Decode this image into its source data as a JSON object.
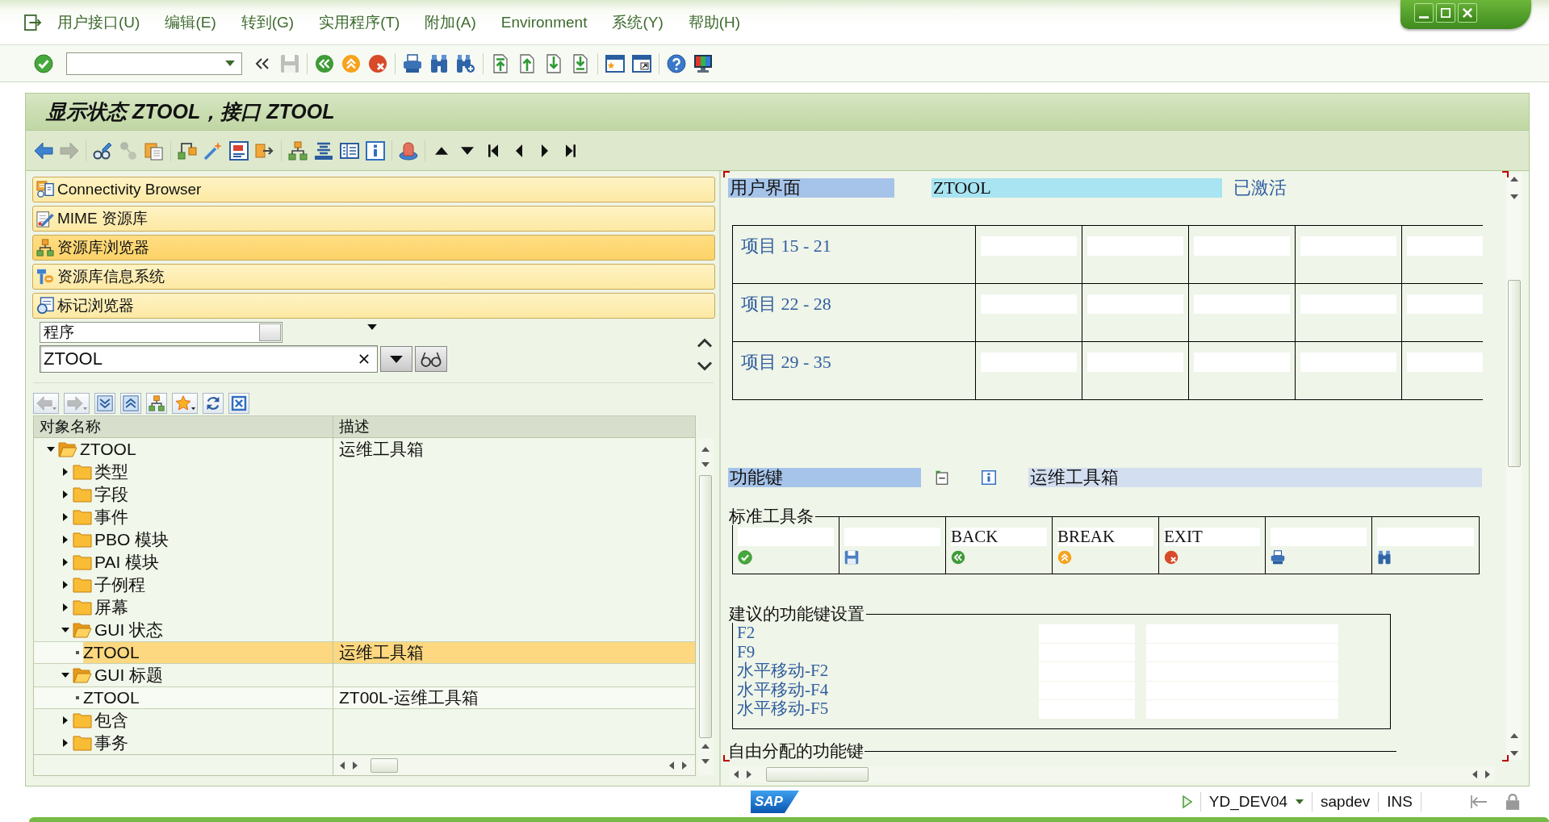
{
  "menu_bar": {
    "items": [
      "用户接口(U)",
      "编辑(E)",
      "转到(G)",
      "实用程序(T)",
      "附加(A)",
      "Environment",
      "系统(Y)",
      "帮助(H)"
    ]
  },
  "system_toolbar": {
    "save": {
      "disabled": true
    }
  },
  "title": "显示状态 ZTOOL，接口 ZTOOL",
  "application_toolbar": {
    "forward": {
      "disabled": true
    },
    "active_inactive": {
      "disabled": true
    }
  },
  "navigation": [
    {
      "label": "Connectivity Browser",
      "selected": false
    },
    {
      "label": "MIME 资源库",
      "selected": false
    },
    {
      "label": "资源库浏览器",
      "selected": true
    },
    {
      "label": "资源库信息系统",
      "selected": false
    },
    {
      "label": "标记浏览器",
      "selected": false
    }
  ],
  "object_selection": {
    "type_field": {
      "value": "程序"
    },
    "name_field": {
      "value": "ZTOOL"
    }
  },
  "tree_toolbar": {
    "back": {
      "disabled": true
    },
    "forward": {
      "disabled": true
    }
  },
  "object_tree": {
    "columns": [
      "对象名称",
      "描述"
    ],
    "nodes": [
      {
        "name": "ZTOOL",
        "description": "运维工具箱",
        "kind": "folder",
        "expanded": true,
        "selected": false,
        "children": [
          {
            "name": "类型",
            "kind": "folder",
            "expanded": false,
            "selected": false
          },
          {
            "name": "字段",
            "kind": "folder",
            "expanded": false,
            "selected": false
          },
          {
            "name": "事件",
            "kind": "folder",
            "expanded": false,
            "selected": false
          },
          {
            "name": "PBO 模块",
            "kind": "folder",
            "expanded": false,
            "selected": false
          },
          {
            "name": "PAI 模块",
            "kind": "folder",
            "expanded": false,
            "selected": false
          },
          {
            "name": "子例程",
            "kind": "folder",
            "expanded": false,
            "selected": false
          },
          {
            "name": "屏幕",
            "kind": "folder",
            "expanded": false,
            "selected": false
          },
          {
            "name": "GUI 状态",
            "kind": "folder",
            "expanded": true,
            "selected": false,
            "children": [
              {
                "name": "ZTOOL",
                "description": "运维工具箱",
                "kind": "object",
                "selected": true
              }
            ]
          },
          {
            "name": "GUI 标题",
            "kind": "folder",
            "expanded": true,
            "selected": false,
            "children": [
              {
                "name": "ZTOOL",
                "description": "ZT00L-运维工具箱",
                "kind": "object",
                "selected": false
              }
            ]
          },
          {
            "name": "包含",
            "kind": "folder",
            "expanded": false,
            "selected": false
          },
          {
            "name": "事务",
            "kind": "folder",
            "expanded": false,
            "selected": false
          }
        ]
      }
    ]
  },
  "status_editor": {
    "interface": {
      "label": "用户界面",
      "value": "ZTOOL",
      "status": "已激活"
    },
    "menu_rows": [
      "项目 15 - 21",
      "项目 22 - 28",
      "项目 29 - 35"
    ],
    "function_keys": {
      "label": "功能键",
      "description": "运维工具箱"
    },
    "standard_toolbar": {
      "title": "标准工具条",
      "buttons": [
        {
          "kind": "enter"
        },
        {
          "kind": "save"
        },
        {
          "kind": "back",
          "value": "BACK"
        },
        {
          "kind": "cancel",
          "value": "BREAK"
        },
        {
          "kind": "exit",
          "value": "EXIT"
        },
        {
          "kind": "print"
        },
        {
          "kind": "find"
        }
      ]
    },
    "recommended_keys": {
      "title": "建议的功能键设置",
      "keys": [
        "F2",
        "F9",
        "水平移动-F2",
        "水平移动-F4",
        "水平移动-F5"
      ]
    },
    "free_keys": {
      "title": "自由分配的功能键"
    }
  },
  "status_bar": {
    "logo": "SAP",
    "system": "YD_DEV04",
    "client": "sapdev",
    "mode": "INS"
  }
}
